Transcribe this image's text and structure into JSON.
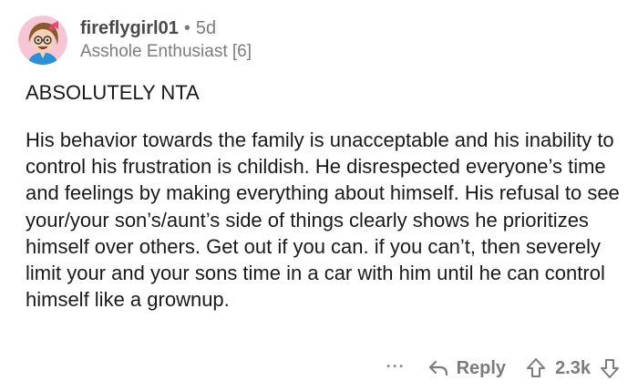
{
  "comment": {
    "username": "fireflygirl01",
    "separator": "•",
    "age": "5d",
    "flair": "Asshole Enthusiast [6]",
    "headline": "ABSOLUTELY NTA",
    "body": "His behavior towards the family is unacceptable and his inability to control his frustration is childish. He disrespected everyone’s time and feelings by making everything about himself. His refusal to see your/your son’s/aunt’s side of things clearly shows he prioritizes himself over others. Get out if you can. if you can’t, then severely limit your and your sons time in a car with him until he can control himself like a grownup."
  },
  "actions": {
    "more_label": "···",
    "reply_label": "Reply",
    "score": "2.3k"
  },
  "icons": {
    "avatar": "avatar-cartoon-girl",
    "reply": "reply-arrow-icon",
    "upvote": "upvote-arrow-icon",
    "downvote": "downvote-arrow-icon"
  },
  "colors": {
    "avatar_bg": "#f7c6d6",
    "text": "#1a1a1b",
    "muted": "#7c7c7c"
  }
}
